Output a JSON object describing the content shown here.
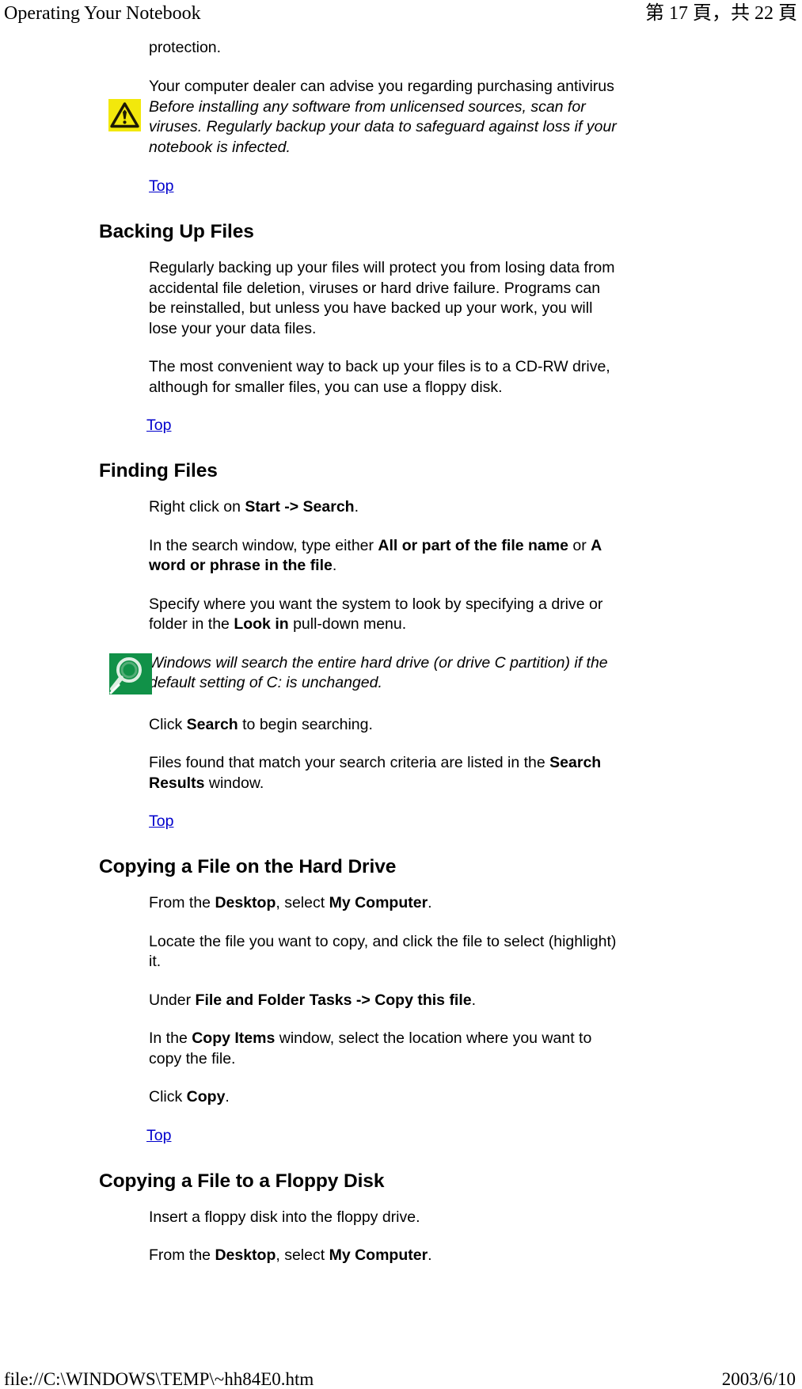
{
  "header": {
    "title": "Operating Your Notebook",
    "page_indicator": "第 17 頁，共 22 頁"
  },
  "footer": {
    "file_path": "file://C:\\WINDOWS\\TEMP\\~hh84E0.htm",
    "date": "2003/6/10"
  },
  "content": {
    "antivirus_tail": "protection.",
    "antivirus_clipped": "Your computer dealer can advise you regarding purchasing antivirus",
    "warning_note": "Before installing any software from unlicensed sources, scan for viruses. Regularly backup your data to safeguard against loss if your notebook is infected.",
    "top_link_label": "Top",
    "backing_up": {
      "heading": "Backing Up Files",
      "p1": "Regularly backing up your files will protect you from losing data from accidental file deletion, viruses or hard drive failure. Programs can be reinstalled, but unless you have backed up your work, you will lose your your data files.",
      "p2": "The most convenient way to back up your files is to a CD-RW drive, although for smaller files, you can use a floppy disk."
    },
    "finding_files": {
      "heading": "Finding Files",
      "step1_pre": "Right click on ",
      "step1_bold": "Start -> Search",
      "step1_post": ".",
      "step2_pre": "In the search window, type either ",
      "step2_bold1": "All or part of the file name",
      "step2_mid": " or ",
      "step2_bold2": "A word or phrase in the file",
      "step2_post": ".",
      "step3_pre": "Specify where you want the system to look by specifying a drive or folder in the ",
      "step3_bold": "Look in",
      "step3_post": " pull-down menu.",
      "search_note": "Windows will search the entire hard drive (or drive C partition) if the default setting of C: is unchanged.",
      "step4_pre": "Click ",
      "step4_bold": "Search",
      "step4_post": " to begin searching.",
      "step5_pre": "Files found that match your search criteria are listed in the ",
      "step5_bold": "Search Results",
      "step5_post": " window."
    },
    "copy_hard_drive": {
      "heading": "Copying a File on the Hard Drive",
      "step1_pre": "From the ",
      "step1_bold1": "Desktop",
      "step1_mid": ", select ",
      "step1_bold2": "My Computer",
      "step1_post": ".",
      "step2": "Locate the file you want to copy, and click the file to select (highlight) it.",
      "step3_pre": "Under ",
      "step3_bold": "File and Folder Tasks -> Copy this file",
      "step3_post": ".",
      "step4_pre": "In the ",
      "step4_bold": "Copy Items",
      "step4_post": " window, select the location where you want to copy the file.",
      "step5_pre": "Click ",
      "step5_bold": "Copy",
      "step5_post": "."
    },
    "copy_floppy": {
      "heading": "Copying a File to a Floppy Disk",
      "step1": "Insert a floppy disk into the floppy drive.",
      "step2_pre": "From the ",
      "step2_bold1": "Desktop",
      "step2_mid": ", select ",
      "step2_bold2": "My Computer",
      "step2_post": "."
    }
  },
  "icons": {
    "warning": "warning-triangle-icon",
    "search": "magnifier-icon"
  },
  "colors": {
    "link": "#0000cc",
    "warning_bg": "#f2e80c",
    "search_bg": "#119148",
    "text": "#000000",
    "page_bg": "#ffffff"
  }
}
